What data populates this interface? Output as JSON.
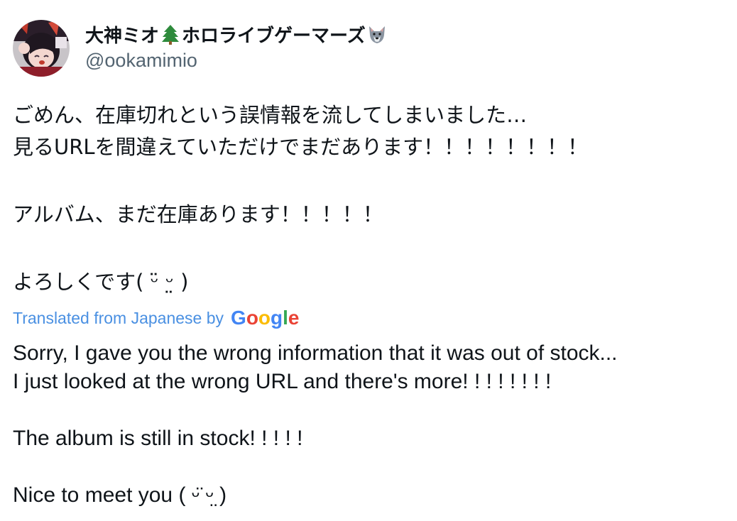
{
  "header": {
    "display_name_part1": "大神ミオ",
    "display_name_part2": "ホロライブゲーマーズ",
    "handle": "@ookamimio",
    "icons": [
      "tree-emoji-icon",
      "wolf-emoji-icon"
    ],
    "avatar_icon": "avatar-image"
  },
  "tweet": {
    "line1": "ごめん、在庫切れという誤情報を流してしまいました…",
    "line2": "見るURLを間違えていただけでまだあります！！！！！！！！",
    "line3": "アルバム、まだ在庫あります！！！！！",
    "line4": "よろしくです( ᵕ̈  ᵕ̤ )"
  },
  "translation_banner": {
    "label": "Translated from Japanese by",
    "logo_text": "Google"
  },
  "translation": {
    "line1": "Sorry, I gave you the wrong information that it was out of stock...",
    "line2": "I just looked at the wrong URL and there's more! ! ! ! ! ! ! !",
    "line3": "The album is still in stock! ! ! ! !",
    "line4": "Nice to meet you ( ᵕ̈  ᵕ̤ )"
  },
  "colors": {
    "text": "#0f1419",
    "secondary": "#536471",
    "link_blue": "#4a90e2",
    "google_blue": "#4285f4",
    "google_red": "#ea4335",
    "google_yellow": "#fbbc05",
    "google_green": "#34a853"
  }
}
